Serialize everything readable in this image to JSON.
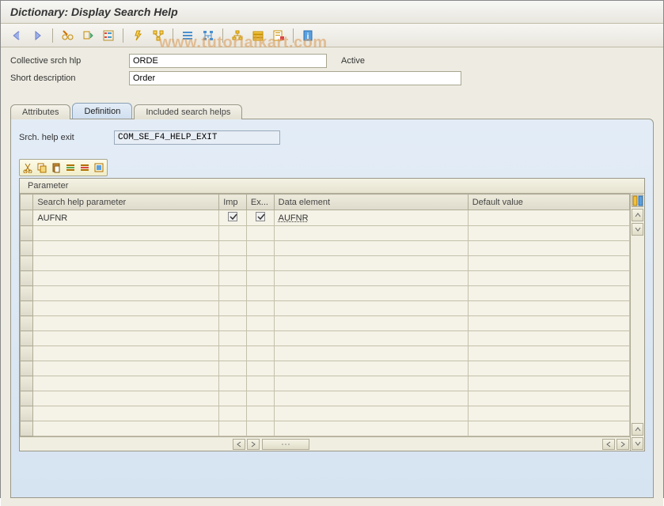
{
  "title": "Dictionary: Display Search Help",
  "watermark": "www.tutorialkart.com",
  "toolbar_icons": [
    {
      "name": "back-icon"
    },
    {
      "name": "forward-icon"
    },
    {
      "sep": true
    },
    {
      "name": "display-change-icon"
    },
    {
      "name": "other-object-icon"
    },
    {
      "name": "check-icon"
    },
    {
      "sep": true
    },
    {
      "name": "activate-icon"
    },
    {
      "name": "where-used-icon"
    },
    {
      "sep": true
    },
    {
      "name": "display-list-icon"
    },
    {
      "name": "object-directory-icon"
    },
    {
      "sep": true
    },
    {
      "name": "hierarchy-icon"
    },
    {
      "name": "technical-settings-icon"
    },
    {
      "name": "append-icon"
    },
    {
      "sep": true
    },
    {
      "name": "documentation-icon"
    }
  ],
  "form": {
    "srch_hlp_label": "Collective srch hlp",
    "srch_hlp_value": "ORDE",
    "status": "Active",
    "short_desc_label": "Short description",
    "short_desc_value": "Order"
  },
  "tabs": {
    "attributes": "Attributes",
    "definition": "Definition",
    "included": "Included search helps"
  },
  "panel": {
    "exit_label": "Srch. help exit",
    "exit_value": "COM_SE_F4_HELP_EXIT"
  },
  "mini_toolbar": [
    "cut-icon",
    "copy-icon",
    "paste-icon",
    "insert-row-icon",
    "delete-row-icon",
    "select-all-icon"
  ],
  "grid": {
    "title": "Parameter",
    "columns": {
      "param": "Search help parameter",
      "imp": "Imp",
      "exp": "Ex...",
      "de": "Data element",
      "def": "Default value"
    },
    "rows": [
      {
        "param": "AUFNR",
        "imp": true,
        "exp": true,
        "de": "AUFNR",
        "def": ""
      }
    ],
    "blank_rows": 14
  }
}
